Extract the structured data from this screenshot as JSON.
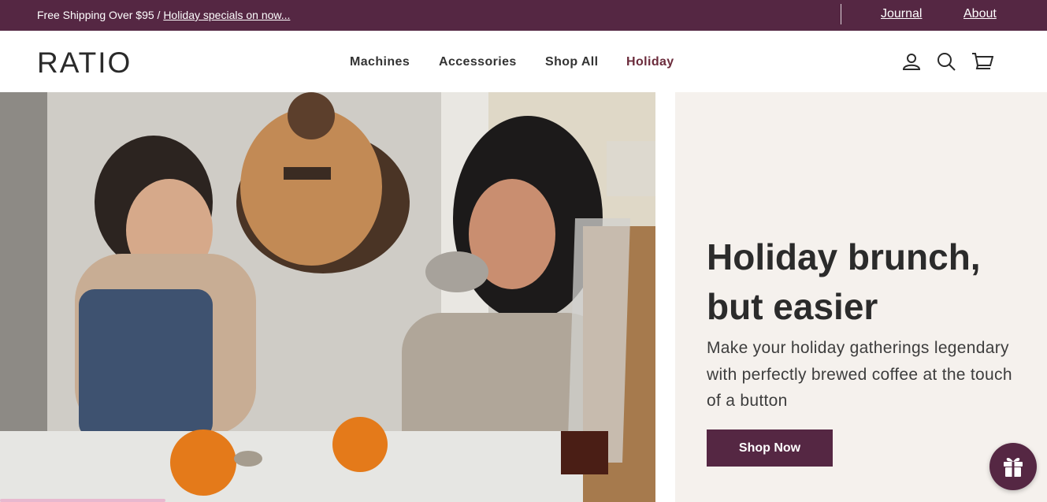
{
  "announcement": {
    "text": "Free Shipping Over $95 / ",
    "link": "Holiday specials on now..."
  },
  "top_links": [
    "Journal",
    "About"
  ],
  "logo": "RATIO",
  "nav": [
    "Machines",
    "Accessories",
    "Shop All",
    "Holiday"
  ],
  "header_icons": [
    "account-icon",
    "search-icon",
    "cart-icon"
  ],
  "hero": {
    "title": "Holiday brunch, but easier",
    "subtitle": "Make your holiday gatherings legendary with perfectly brewed coffee at the touch of a button",
    "cta": "Shop Now"
  },
  "gift_icon": "gift-icon",
  "colors": {
    "brand": "#552743",
    "holiday_link": "#6b2b3b",
    "panel_bg": "#f5f1ed"
  }
}
